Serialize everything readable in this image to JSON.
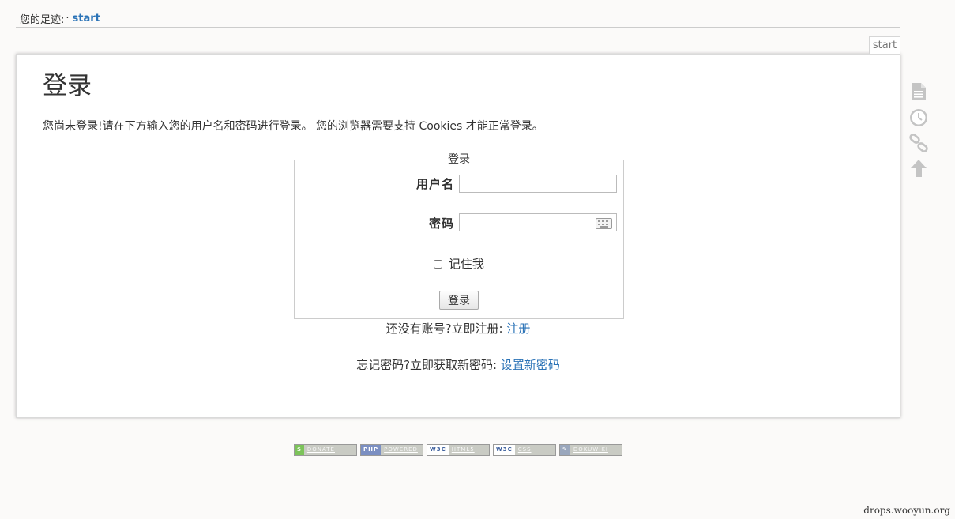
{
  "breadcrumbs": {
    "label": "您的足迹:",
    "separator": "·",
    "current": "start"
  },
  "page_tab": {
    "label": "start"
  },
  "main": {
    "title": "登录",
    "intro": "您尚未登录!请在下方输入您的用户名和密码进行登录。 您的浏览器需要支持 Cookies 才能正常登录。",
    "login_form": {
      "legend": "登录",
      "username_label": "用户名",
      "username_value": "",
      "password_label": "密码",
      "password_value": "",
      "remember_label": "记住我",
      "remember_checked": false,
      "submit_label": "登录"
    },
    "register": {
      "text": "还没有账号?立即注册:",
      "link": "注册"
    },
    "reset": {
      "text": "忘记密码?立即获取新密码:",
      "link": "设置新密码"
    }
  },
  "tools": {
    "items": [
      {
        "icon": "page-icon"
      },
      {
        "icon": "history-icon"
      },
      {
        "icon": "backlinks-icon"
      },
      {
        "icon": "back-to-top-icon"
      }
    ]
  },
  "footer_badges": [
    {
      "tag": "$",
      "text": "DONATE",
      "tag_color": "#7cc35a"
    },
    {
      "tag": "PHP",
      "text": "POWERED",
      "tag_color": "#7b8fc2"
    },
    {
      "tag": "W3C",
      "text": "HTML5",
      "tag_color": "#ffffff"
    },
    {
      "tag": "W3C",
      "text": "CSS",
      "tag_color": "#ffffff"
    },
    {
      "tag": "",
      "text": "DOKUWIKI",
      "tag_color": "#9aa7bd"
    }
  ],
  "watermark": "drops.wooyun.org",
  "colors": {
    "link": "#2b73b7",
    "text": "#333333",
    "background": "#fbfaf9",
    "card": "#ffffff",
    "icon": "#bbbbbb"
  }
}
